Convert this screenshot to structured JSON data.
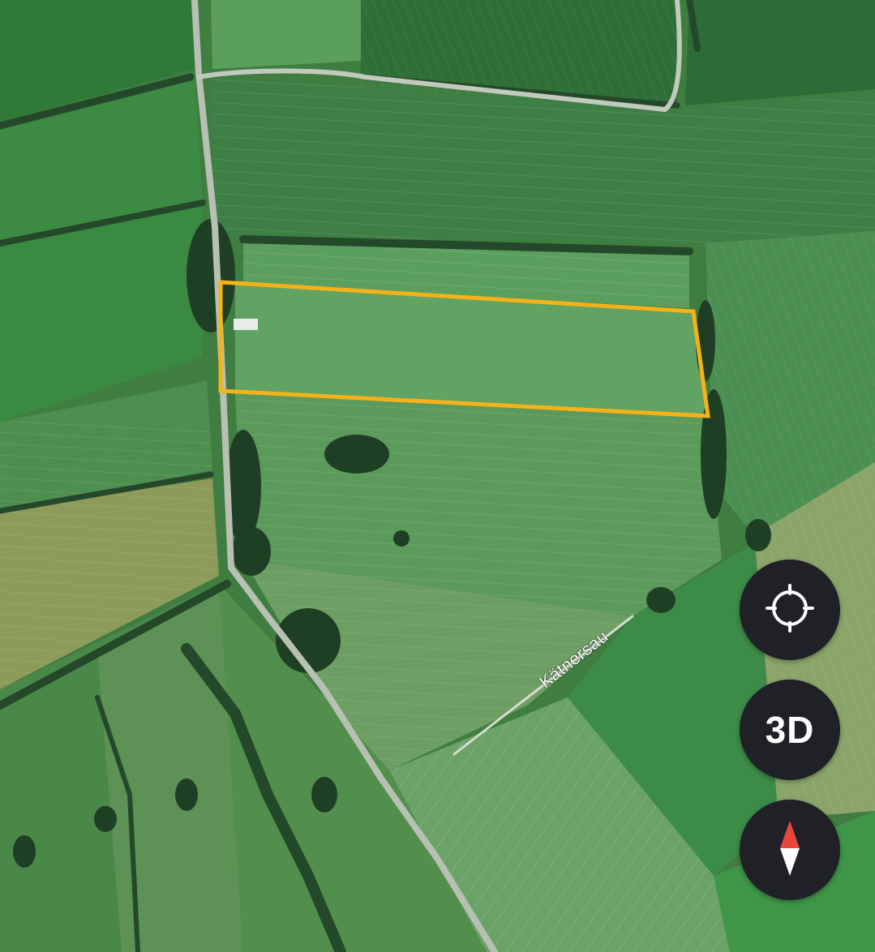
{
  "map": {
    "type": "satellite",
    "road_labels": [
      {
        "id": "katnersau",
        "text": "Kätnersau"
      }
    ],
    "highlight": {
      "shape": "parcel-outline",
      "color": "#f6b21a"
    }
  },
  "controls": {
    "locate": {
      "icon": "crosshair-icon"
    },
    "view3d": {
      "label": "3D"
    },
    "compass": {
      "icon": "compass-needle-icon",
      "north_color": "#e8453c",
      "south_color": "#ffffff"
    }
  },
  "colors": {
    "button_bg": "#1f2126",
    "button_fg": "#ffffff"
  }
}
